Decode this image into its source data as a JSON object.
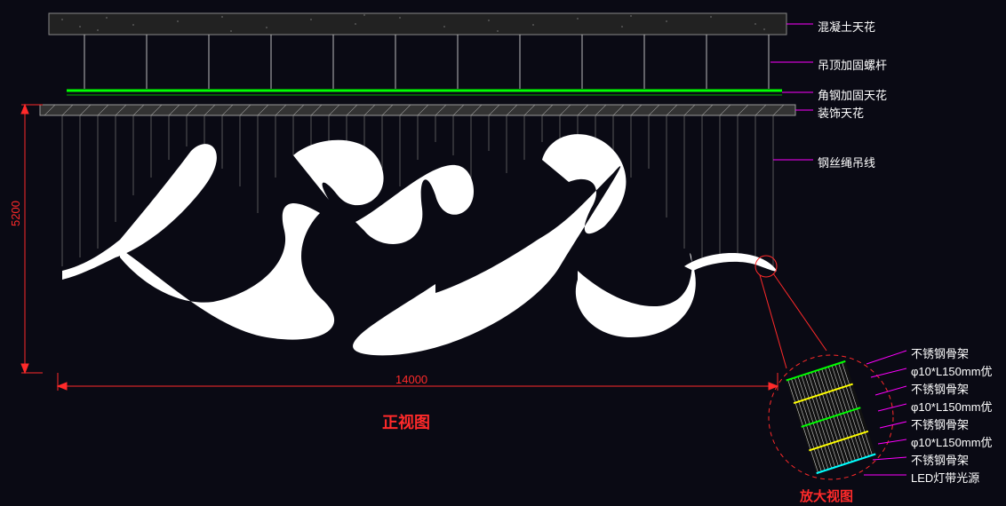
{
  "labels": {
    "concrete_ceiling": "混凝土天花",
    "screw_rod": "吊顶加固螺杆",
    "angle_steel": "角钢加固天花",
    "decor_ceiling": "装饰天花",
    "wire_rope": "钢丝绳吊线",
    "ss_frame_1": "不锈钢骨架",
    "fiber_1": "φ10*L150mm优",
    "ss_frame_2": "不锈钢骨架",
    "fiber_2": "φ10*L150mm优",
    "ss_frame_3": "不锈钢骨架",
    "fiber_3": "φ10*L150mm优",
    "ss_frame_4": "不锈钢骨架",
    "led_strip": "LED灯带光源"
  },
  "titles": {
    "front_view": "正视图",
    "enlarged_view": "放大视图"
  },
  "dimensions": {
    "height": "5200",
    "width": "14000"
  }
}
